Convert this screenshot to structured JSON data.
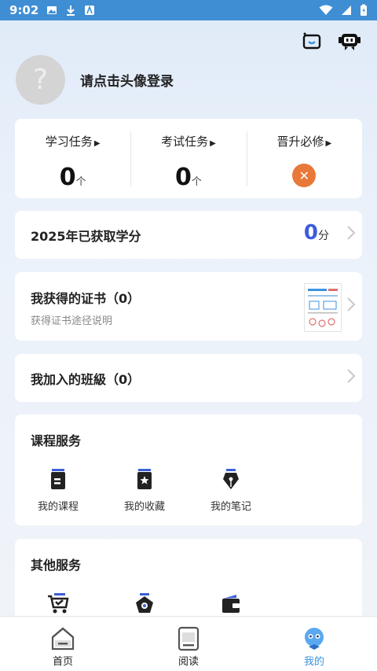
{
  "status_bar": {
    "time": "9:02"
  },
  "profile": {
    "avatar_glyph": "?",
    "login_text": "请点击头像登录"
  },
  "tasks": [
    {
      "label": "学习任务",
      "value": "0",
      "unit": "个"
    },
    {
      "label": "考试任务",
      "value": "0",
      "unit": "个"
    },
    {
      "label": "晋升必修",
      "status": "not-available"
    }
  ],
  "credit": {
    "label": "2025年已获取学分",
    "value": "0",
    "unit": "分"
  },
  "certificate": {
    "label": "我获得的证书（0）",
    "sub": "获得证书途径说明"
  },
  "classes": {
    "label": "我加入的班級（0）"
  },
  "course_service": {
    "title": "课程服务",
    "items": [
      {
        "label": "我的课程",
        "icon": "book-icon"
      },
      {
        "label": "我的收藏",
        "icon": "star-bookmark-icon"
      },
      {
        "label": "我的笔记",
        "icon": "pen-nib-icon"
      }
    ]
  },
  "other_service": {
    "title": "其他服务",
    "items": [
      {
        "icon": "cart-check-icon"
      },
      {
        "icon": "pentagon-icon"
      },
      {
        "icon": "wallet-icon"
      }
    ]
  },
  "tabbar": {
    "tabs": [
      {
        "label": "首页",
        "icon": "home-icon"
      },
      {
        "label": "阅读",
        "icon": "reader-icon"
      },
      {
        "label": "我的",
        "icon": "robot-face-icon",
        "active": true
      }
    ]
  },
  "colors": {
    "accent": "#3b93e2",
    "credit_value": "#3d5cdc",
    "badge_orange": "#e8793a",
    "statusbar": "#3f8ed4"
  }
}
